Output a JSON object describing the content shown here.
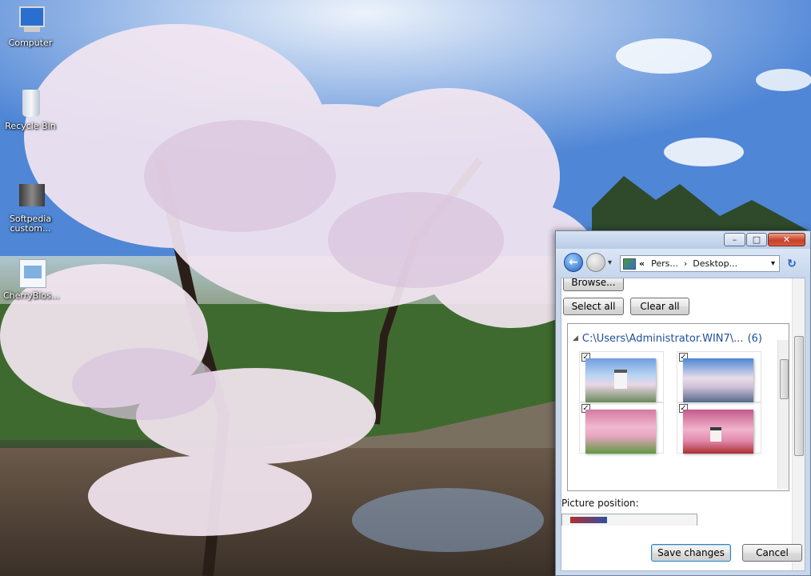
{
  "desktop": {
    "icons": [
      {
        "label": "Computer",
        "icon": "computer-icon"
      },
      {
        "label": "Recycle Bin",
        "icon": "recycle-bin-icon"
      },
      {
        "label": "Softpedia custom...",
        "icon": "folder-icon"
      },
      {
        "label": "CherryBlos...",
        "icon": "theme-pack-icon"
      }
    ]
  },
  "window": {
    "caption_buttons": {
      "minimize": "–",
      "maximize": "□",
      "close": "✕"
    },
    "nav": {
      "back_glyph": "←",
      "overflow_glyph": "«",
      "breadcrumb": [
        "Pers...",
        "Desktop..."
      ],
      "separator": "›",
      "dropdown_glyph": "▾",
      "refresh_glyph": "↻"
    },
    "browse_label": "Browse...",
    "select_all_label": "Select all",
    "clear_all_label": "Clear all",
    "group": {
      "collapse_glyph": "◢",
      "path": "C:\\Users\\Administrator.WIN7\\...",
      "count": "(6)"
    },
    "thumbnails": [
      {
        "checked": "✓",
        "scene": "castle-blossoms"
      },
      {
        "checked": "✓",
        "scene": "river-blossoms"
      },
      {
        "checked": "✓",
        "scene": "park-blossoms"
      },
      {
        "checked": "✓",
        "scene": "red-bridge-castle"
      }
    ],
    "picture_position_label": "Picture position:",
    "save_label": "Save changes",
    "cancel_label": "Cancel"
  },
  "colors": {
    "window_frame": "#c9d7ea",
    "link_blue": "#1e4f9c",
    "close_red": "#c8402a"
  }
}
